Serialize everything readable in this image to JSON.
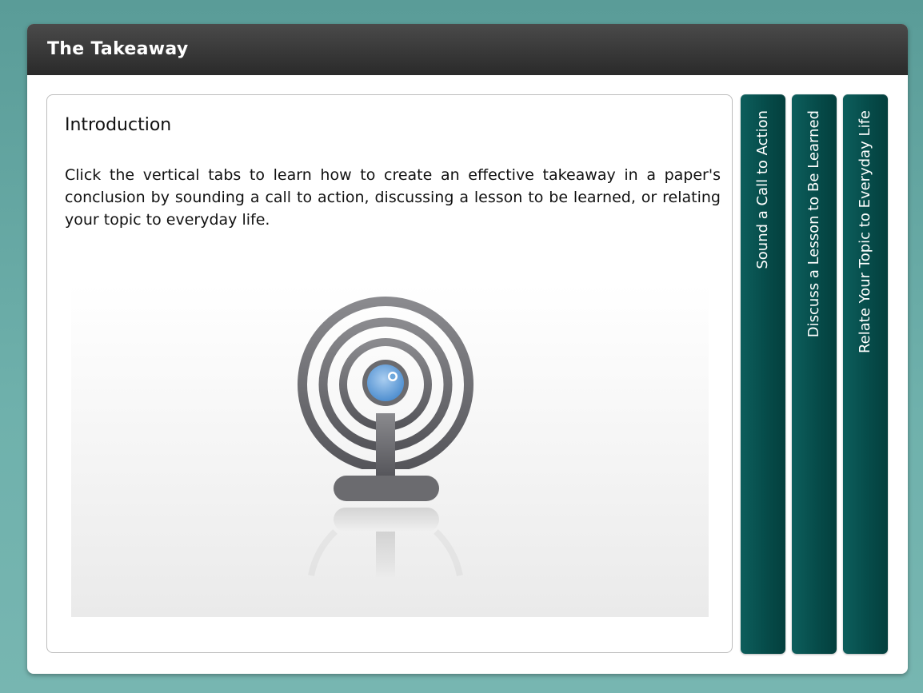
{
  "window": {
    "title": "The Takeaway"
  },
  "content": {
    "heading": "Introduction",
    "body": "Click the vertical tabs to learn how to create an effective takeaway in a paper's conclusion by sounding a call to action, discussing a lesson to be learned, or relating your topic to everyday life.",
    "illustration_icon": "broadcast-antenna-icon"
  },
  "tabs": [
    {
      "label": "Sound a Call to Action"
    },
    {
      "label": "Discuss a Lesson to Be Learned"
    },
    {
      "label": "Relate Your Topic to Everyday Life"
    }
  ],
  "colors": {
    "background": "#6fb1ac",
    "titlebar": "#2f2f2f",
    "tab": "#064c4a",
    "icon_gray": "#6b6b6f",
    "icon_blue": "#6fa8dc"
  }
}
